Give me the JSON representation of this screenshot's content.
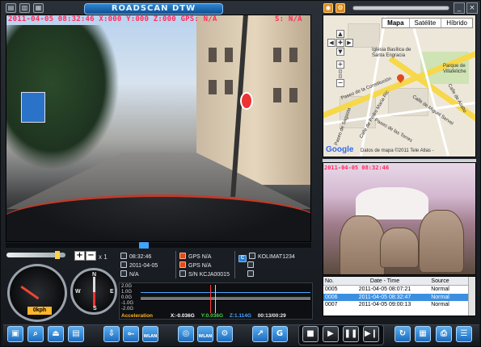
{
  "app": {
    "title": "ROADSCAN DTW",
    "window_icons": [
      "folder-icon",
      "print-icon",
      "save-icon"
    ],
    "right_icons": [
      "map-icon",
      "settings-icon"
    ],
    "window_controls": [
      "minimize-icon",
      "close-icon"
    ]
  },
  "video": {
    "osd_text": "2011-04-05  08:32:46  X:000 Y:000 Z:000  GPS: N/A",
    "osd_sn": "S: N/A"
  },
  "map": {
    "tabs": [
      "Mapa",
      "Satélite",
      "Híbrido"
    ],
    "active_tab": "Mapa",
    "nav_arrows": [
      "▲",
      "◀",
      "✚",
      "▶",
      "▼"
    ],
    "zoom_in": "+",
    "zoom_out": "−",
    "labels": [
      "Iglesia Basílica de",
      "Santa Engracia",
      "Parque de",
      "Villafeliche",
      "Paseo de la Constitución",
      "Paseo de Sagasta",
      "Calle de Pedro María Ric",
      "Paseo de las Torres",
      "Calle de Miguel Servet",
      "Calle de Asalto"
    ],
    "google": "Google",
    "copyright": "Datos de mapa ©2011 Tele Atlas -"
  },
  "cabin": {
    "osd_text": "2011-04-05  08:32:46"
  },
  "controls": {
    "plus": "+",
    "minus": "−",
    "speed": "x 1",
    "kph": "0kph",
    "compass": [
      "N",
      "E",
      "S",
      "W"
    ]
  },
  "info": {
    "time": "08:32:46",
    "date": "2011-04-05",
    "location": "N/A",
    "gps1": "GPS N/A",
    "gps2": "GPS N/A",
    "sn": "S/N  KCJA00015",
    "plate_badge": "C",
    "plate": "KOLIMAT1234"
  },
  "graph": {
    "labels": [
      "2.0G",
      "1.0G",
      "0.0G",
      "-1.0G",
      "-2.0G"
    ],
    "title": "Acceleration",
    "x": "X:-0.036G",
    "y": "Y:0.036G",
    "z": "Z:1.114G",
    "time": "00:13/00:29",
    "colors": {
      "x": "#ffffff",
      "y": "#48d34a",
      "z": "#4aa8ff"
    }
  },
  "events": {
    "columns": [
      "No.",
      "Date - Time",
      "Source"
    ],
    "rows": [
      {
        "no": "0005",
        "datetime": "2011-04-05  08:07:21",
        "source": "Normal",
        "selected": false
      },
      {
        "no": "0006",
        "datetime": "2011-04-05  08:32:47",
        "source": "Normal",
        "selected": true
      },
      {
        "no": "0007",
        "datetime": "2011-04-05  09:00:13",
        "source": "Normal",
        "selected": false
      }
    ]
  },
  "playback": {
    "progress": 0.45,
    "volume": 0.9
  },
  "toolbar": {
    "left_buttons": [
      "camera-icon",
      "search-icon",
      "eject-icon",
      "keyboard-icon"
    ],
    "mid_buttons": [
      "download-icon",
      "usb-icon",
      "wlan-icon"
    ],
    "mid_labels": {
      "wlan1": "WLAN",
      "wlan2": "WLAN"
    },
    "right_buttons": [
      "wifi-icon",
      "wlan-icon",
      "settings-icon",
      "chart-icon",
      "google-icon"
    ],
    "player": [
      "stop-icon",
      "play-icon",
      "pause-icon",
      "next-icon"
    ],
    "end_buttons": [
      "refresh-icon",
      "grid-icon",
      "print-icon",
      "list-icon"
    ],
    "g_label": "G"
  }
}
